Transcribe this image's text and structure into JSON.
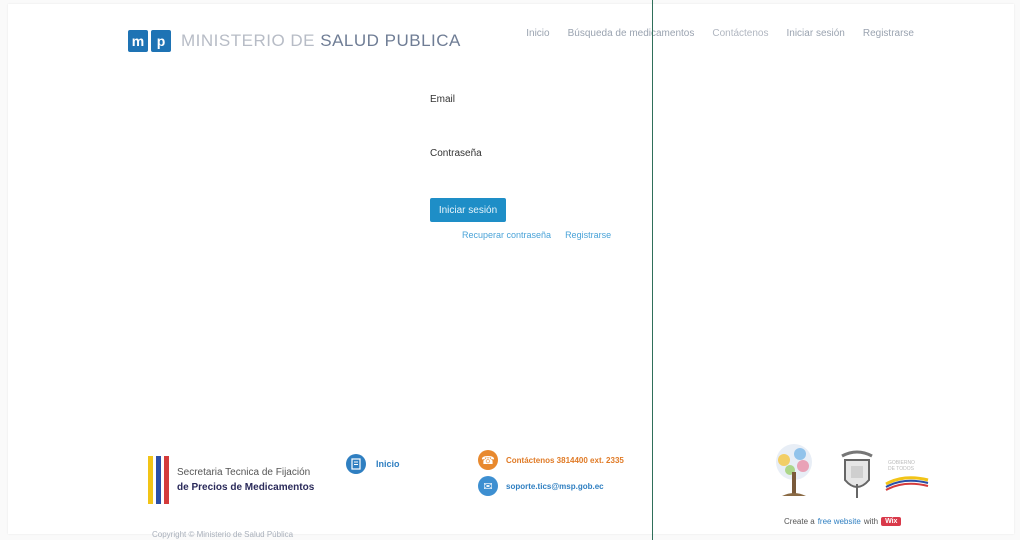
{
  "header": {
    "logo_letters": [
      "m",
      "p"
    ],
    "logo_text_light": "MINISTERIO DE ",
    "logo_text_strong": "SALUD PUBLICA",
    "nav": [
      "Inicio",
      "Búsqueda de medicamentos",
      "Contáctenos",
      "Iniciar sesión",
      "Registrarse"
    ]
  },
  "form": {
    "email_label": "Email",
    "email_value": "",
    "password_label": "Contraseña",
    "password_value": "",
    "submit_label": "Iniciar sesión",
    "recover_link": "Recuperar contraseña",
    "register_link": "Registrarse"
  },
  "footer": {
    "stf_line1": "Secretaria Tecnica de Fijación",
    "stf_line2": "de Precios de Medicamentos",
    "inicio_label": "Inicio",
    "phone": "Contáctenos 3814400 ext. 2335",
    "email": "soporte.tics@msp.gob.ec",
    "copyright": "Copyright © Ministerio de Salud Pública",
    "wix_prefix": "Create a",
    "wix_link": "free website",
    "wix_with": "with",
    "wix_badge": "Wix",
    "gov_mark": "GOBIERNO DE TODOS"
  },
  "colors": {
    "brand_blue": "#1e73b4",
    "button_blue": "#1e8ec7",
    "link_blue": "#4aa3d8",
    "orange": "#e8892e",
    "divider_green": "#2f6f5a"
  },
  "icons": {
    "inicio": "book-icon",
    "phone": "phone-icon",
    "email": "email-icon"
  }
}
